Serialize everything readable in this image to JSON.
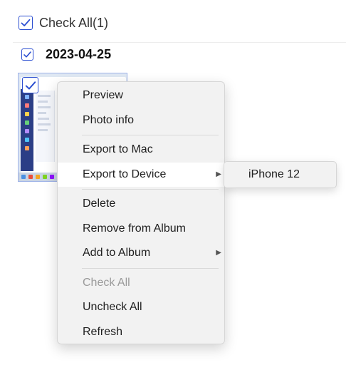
{
  "header": {
    "check_all_label": "Check All(1)"
  },
  "group": {
    "date": "2023-04-25"
  },
  "context_menu": {
    "section1": [
      "Preview",
      "Photo info"
    ],
    "section2": [
      {
        "label": "Export to Mac"
      },
      {
        "label": "Export to Device",
        "has_submenu": true,
        "highlighted": true
      }
    ],
    "section3": [
      {
        "label": "Delete"
      },
      {
        "label": "Remove from Album"
      },
      {
        "label": "Add to Album",
        "has_submenu": true
      }
    ],
    "section4": [
      {
        "label": "Check All",
        "disabled": true
      },
      {
        "label": "Uncheck All"
      },
      {
        "label": "Refresh"
      }
    ],
    "submenu_arrow": "▶"
  },
  "submenu": {
    "items": [
      "iPhone 12"
    ]
  },
  "colors": {
    "checkbox_accent": "#2c4fd1",
    "menu_bg": "#f2f2f2",
    "menu_highlight": "#ffffff",
    "disabled_text": "#9a9a9a"
  }
}
